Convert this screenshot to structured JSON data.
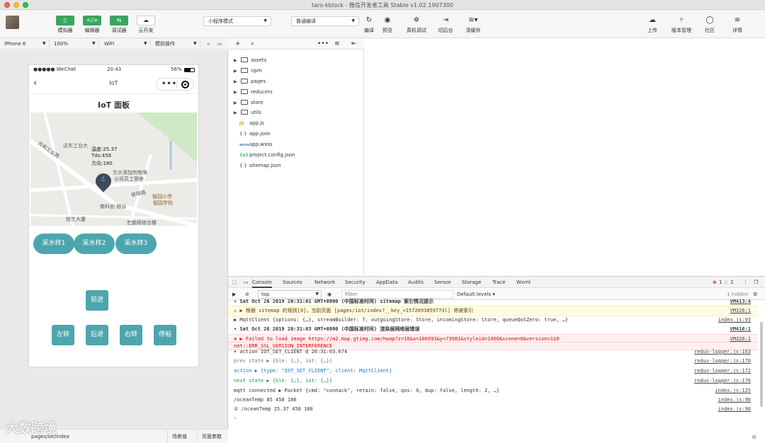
{
  "window": {
    "title": "taro-kblock - 微信开发者工具 Stable v1.02.1907300"
  },
  "toolbar": {
    "simulator": "模拟器",
    "editor": "编辑器",
    "debugger": "调试器",
    "cloud": "云开发",
    "mode_select": "小程序模式",
    "compile_select": "普通编译",
    "compile": "编译",
    "preview": "预览",
    "remote_debug": "真机调试",
    "background": "切后台",
    "clear_cache": "清缓存",
    "upload": "上传",
    "version": "版本管理",
    "community": "社区",
    "details": "详情"
  },
  "subbar": {
    "device": "iPhone 6",
    "zoom": "100%",
    "network": "WiFi",
    "operation": "模拟操作"
  },
  "phone": {
    "status_carrier": "●●●●● WeChat",
    "status_time": "20:43",
    "status_battery": "56%",
    "nav_title": "IoT",
    "page_title": "IoT 面板",
    "map": {
      "callout_line1": "温度:25.37",
      "callout_line2": "Tds:458",
      "callout_line3": "方向:180",
      "labels": [
        "达东工业大",
        "共和工业路",
        "方大添加剂有限",
        "公司员工宿舍",
        "铁铎路",
        "智园小学",
        "智园学校",
        "南科创·银谷",
        "旭生大厦",
        "宏鹏辉综合楼"
      ]
    },
    "sample_buttons": [
      "采水样1",
      "采水样2",
      "采水样3"
    ],
    "forward": "前进",
    "controls": [
      "左转",
      "后退",
      "右转",
      "停船"
    ]
  },
  "bottom": {
    "path": "pages/iot/index",
    "scene": "场景值",
    "params": "页面参数"
  },
  "filetree": {
    "folders": [
      "assets",
      "npm",
      "pages",
      "reducers",
      "store",
      "utils"
    ],
    "files": [
      {
        "icon": "JS",
        "name": "app.js"
      },
      {
        "icon": "{ }",
        "name": "app.json"
      },
      {
        "icon": "wxss",
        "name": "app.wxss"
      },
      {
        "icon": "{o}",
        "name": "project.config.json"
      },
      {
        "icon": "{ }",
        "name": "sitemap.json"
      }
    ]
  },
  "console": {
    "tabs": [
      "Console",
      "Sources",
      "Network",
      "Security",
      "AppData",
      "Audits",
      "Sensor",
      "Storage",
      "Trace",
      "Wxml"
    ],
    "error_count": "1",
    "warn_count": "2",
    "context": "top",
    "filter_placeholder": "Filter",
    "levels": "Default levels ▾",
    "hidden": "1 hidden",
    "logs": [
      {
        "kind": "group",
        "text": "▾ Sat Oct 26 2019 20:31:01 GMT+0800 (中国标准时间) sitemap 索引情况提示",
        "ref": "VM413:4"
      },
      {
        "kind": "warn",
        "text": "⚠ ▶ 根据 sitemap 的规则[0]，当前页面 [pages/iot/index?__key_=1572093059773l] 将被索引",
        "ref": "VM326:1"
      },
      {
        "kind": "plain",
        "text": "  ▶ MqttClient {options: {…}, streamBuilder: f, outgoingStore: Store, incomingStore: Store, queueQoSZero: true, …}",
        "ref": "index.js:93"
      },
      {
        "kind": "group",
        "text": "▾ Sat Oct 26 2019 20:31:03 GMT+0800 (中国标准时间) 渲染层网络层错误",
        "ref": "VM416:1"
      },
      {
        "kind": "err",
        "text": "⊗ ▶ Failed to load image https://m2.map.gtimg.com/hwap?z=16&x=106993&y=73981&styleid=1000&scene=0&version=110",
        "ref": "VM326:1"
      },
      {
        "kind": "err2",
        "text": "    net::ERR_SSL_VERSION_INTERFERENCE",
        "ref": ""
      },
      {
        "kind": "plain",
        "text": "▾ action IOT_SET_CLIENT @ 20:31:03.674",
        "ref": "redux-logger.js:163"
      },
      {
        "kind": "plain",
        "text": "      prev state ▶ {ble: {…}, iot: {…}}",
        "ref": "redux-logger.js:170"
      },
      {
        "kind": "plain",
        "text": "      action     ▶ {type: \"IOT_SET_CLIENT\", client: MqttClient}",
        "ref": "redux-logger.js:172"
      },
      {
        "kind": "plain",
        "text": "      next state ▶ {ble: {…}, iot: {…}}",
        "ref": "redux-logger.js:176"
      },
      {
        "kind": "plain",
        "text": "  mqtt connected ▶ Packet {cmd: \"connack\", retain: false, qos: 0, dup: false, length: 2, …}",
        "ref": "index.js:125"
      },
      {
        "kind": "plain",
        "text": "  /oceanTemp 85 458 180",
        "ref": "index.js:96"
      },
      {
        "kind": "plain",
        "text": "② /oceanTemp 25.37 458 180",
        "ref": "index.js:96"
      }
    ]
  },
  "watermark": "大数跨境"
}
